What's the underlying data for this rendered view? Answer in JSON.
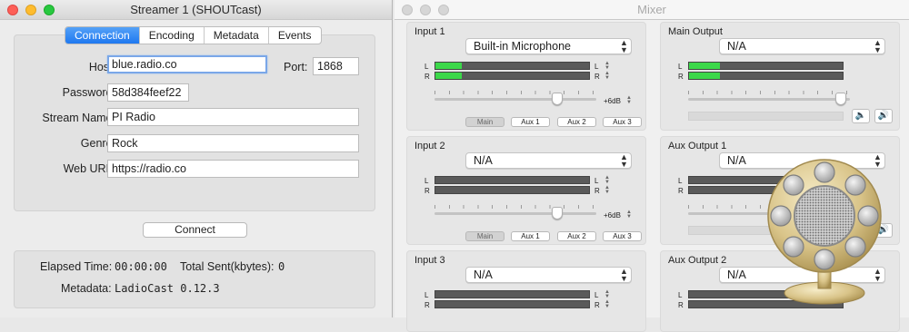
{
  "streamer": {
    "title": "Streamer 1 (SHOUTcast)",
    "tabs": [
      "Connection",
      "Encoding",
      "Metadata",
      "Events"
    ],
    "host_label": "Host:",
    "host": "blue.radio.co",
    "port_label": "Port:",
    "port": "1868",
    "password_label": "Password:",
    "password": "58d384feef22",
    "stream_name_label": "Stream Name:",
    "stream_name": "PI Radio",
    "genre_label": "Genre:",
    "genre": "Rock",
    "web_url_label": "Web URL:",
    "web_url": "https://radio.co",
    "connect_label": "Connect",
    "elapsed_label": "Elapsed Time:",
    "elapsed": "00:00:00",
    "sent_label": "Total Sent(kbytes):",
    "sent": "0",
    "metadata_label": "Metadata:",
    "metadata": "LadioCast 0.12.3"
  },
  "mixer": {
    "title": "Mixer",
    "channel_labels": {
      "left": "L",
      "right": "R"
    },
    "gain_label": "+6dB",
    "aux_labels": [
      "Main",
      "Aux 1",
      "Aux 2",
      "Aux 3"
    ],
    "inputs": [
      {
        "label": "Input 1",
        "device": "Built-in Microphone",
        "level_left": 0.17,
        "level_right": 0.17
      },
      {
        "label": "Input 2",
        "device": "N/A",
        "level_left": 0,
        "level_right": 0
      },
      {
        "label": "Input 3",
        "device": "N/A",
        "level_left": 0,
        "level_right": 0
      }
    ],
    "outputs": [
      {
        "label": "Main Output",
        "device": "N/A",
        "level_left": 0.2,
        "level_right": 0.2
      },
      {
        "label": "Aux Output 1",
        "device": "N/A"
      },
      {
        "label": "Aux Output 2",
        "device": "N/A"
      }
    ]
  },
  "icons": {
    "speaker_low": "🔈",
    "speaker_high": "🔊",
    "chevron_updown": "⌃⌄"
  },
  "colors": {
    "accent": "#1f78f0",
    "meter_fill": "#3cd84a",
    "meter_bg": "#5a5a5a"
  }
}
